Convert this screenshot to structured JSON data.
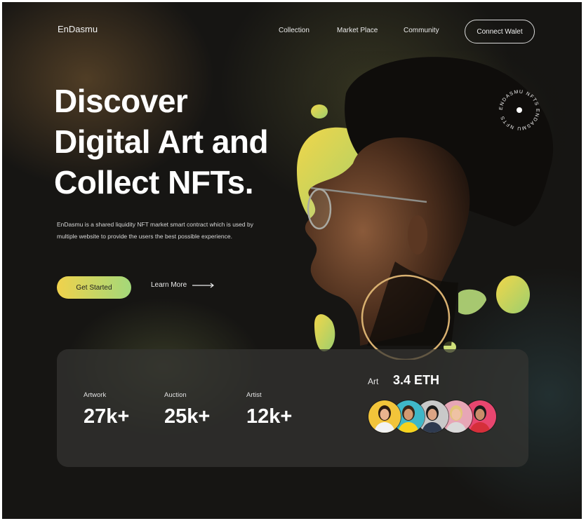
{
  "brand": {
    "name": "EnDasmu"
  },
  "nav": {
    "items": [
      {
        "label": "Collection"
      },
      {
        "label": "Market Place"
      },
      {
        "label": "Community"
      }
    ],
    "connect_label": "Connect Walet"
  },
  "hero": {
    "title_lines": [
      "Discover",
      "Digital Art and",
      "Collect NFTs."
    ],
    "description": "EnDasmu is a shared liquidity NFT market smart contract which is used by multiple website to provide the users the best possible experience.",
    "cta_primary": "Get Started",
    "cta_secondary": "Learn More"
  },
  "badge": {
    "text": "ENDASMU NFTS ENDASMU NFTS "
  },
  "stats": [
    {
      "label": "Artwork",
      "value": "27k+"
    },
    {
      "label": "Auction",
      "value": "25k+"
    },
    {
      "label": "Artist",
      "value": "12k+"
    }
  ],
  "art_price": {
    "label": "Art",
    "value": "3.4 ETH"
  },
  "avatars": [
    {
      "bg": "#f2c43a",
      "skin": "#e9b48f",
      "hair": "#2a1b12",
      "shirt": "#f2f2f2"
    },
    {
      "bg": "#3fb7c8",
      "skin": "#d59a72",
      "hair": "#3a2416",
      "shirt": "#f7d21e"
    },
    {
      "bg": "#c9c9c9",
      "skin": "#dca585",
      "hair": "#1a1a1a",
      "shirt": "#2e3a4f"
    },
    {
      "bg": "#e7a6b6",
      "skin": "#efc2a4",
      "hair": "#e3c57a",
      "shirt": "#d9d9d9"
    },
    {
      "bg": "#e8466f",
      "skin": "#c98d6a",
      "hair": "#1a1a1a",
      "shirt": "#d52f3a"
    }
  ],
  "colors": {
    "accent_gradient_start": "#f0d24c",
    "accent_gradient_end": "#a3d87a",
    "background": "#161513",
    "card": "#343432"
  }
}
